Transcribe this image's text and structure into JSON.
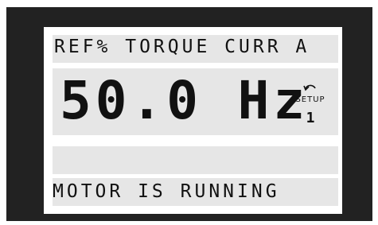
{
  "display": {
    "status_line": "REF% TORQUE CURR A",
    "main_value": "50.0 Hz",
    "setup_label": "SETUP",
    "setup_number": "1",
    "message_line_empty": "",
    "message_line": "MOTOR IS RUNNING"
  },
  "icons": {
    "setup": "curved-arrow-icon"
  },
  "colors": {
    "bezel": "#222222",
    "screen_background": "#ffffff",
    "lcd_row_background": "#e6e6e6",
    "lcd_text": "#111111"
  }
}
